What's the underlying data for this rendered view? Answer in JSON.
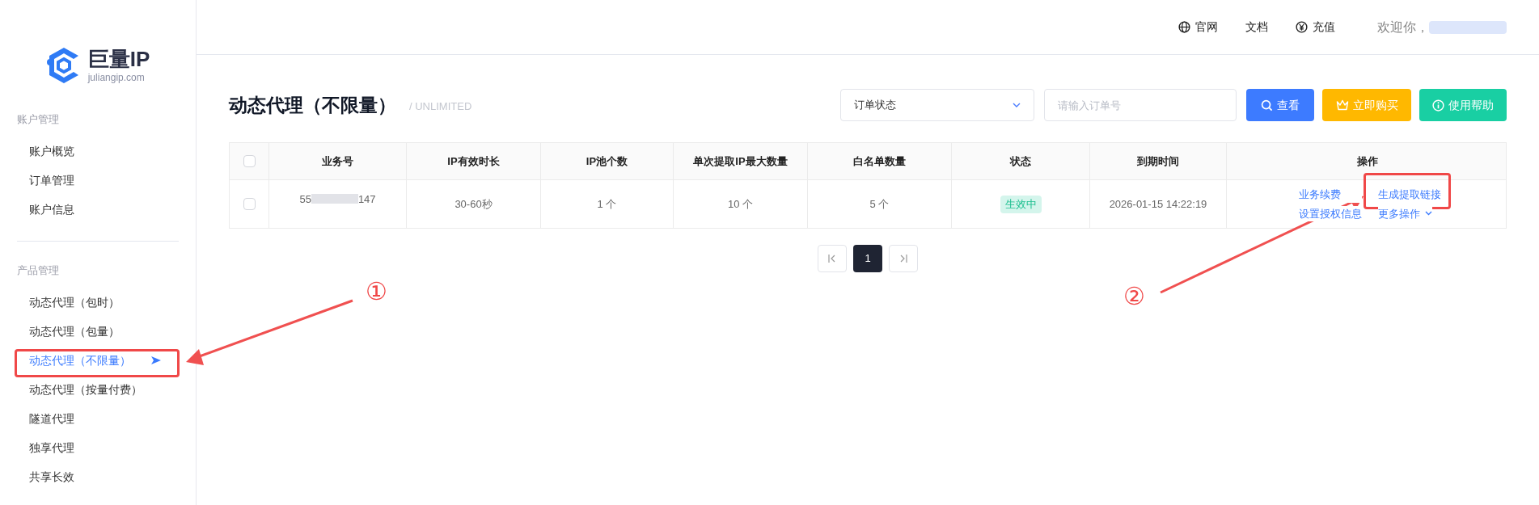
{
  "sidebar": {
    "logo": {
      "name": "巨量IP",
      "domain": "juliangip.com"
    },
    "sections": [
      {
        "title": "账户管理",
        "items": [
          {
            "label": "账户概览",
            "selected": false
          },
          {
            "label": "订单管理",
            "selected": false
          },
          {
            "label": "账户信息",
            "selected": false
          }
        ]
      },
      {
        "title": "产品管理",
        "items": [
          {
            "label": "动态代理（包时）",
            "selected": false
          },
          {
            "label": "动态代理（包量）",
            "selected": false
          },
          {
            "label": "动态代理（不限量）",
            "selected": true
          },
          {
            "label": "动态代理（按量付费）",
            "selected": false
          },
          {
            "label": "隧道代理",
            "selected": false
          },
          {
            "label": "独享代理",
            "selected": false
          },
          {
            "label": "共享长效",
            "selected": false
          }
        ]
      }
    ]
  },
  "header": {
    "links": [
      {
        "label": "官网",
        "kind": "globe"
      },
      {
        "label": "文档",
        "kind": "plain"
      },
      {
        "label": "充值",
        "kind": "yen"
      }
    ],
    "welcome": "欢迎你，"
  },
  "page": {
    "title": "动态代理（不限量）",
    "subtitle": "/ UNLIMITED"
  },
  "filters": {
    "status_select": "订单状态",
    "order_search": {
      "placeholder": "请输入订单号"
    },
    "buttons": [
      {
        "label": "查看",
        "kind": "search"
      },
      {
        "label": "立即购买",
        "kind": "buy"
      },
      {
        "label": "使用帮助",
        "kind": "help"
      }
    ]
  },
  "table": {
    "header_checked": false,
    "columns": [
      "业务号",
      "IP有效时长",
      "IP池个数",
      "单次提取IP最大数量",
      "白名单数量",
      "状态",
      "到期时间",
      "操作"
    ],
    "rows": [
      {
        "checked": false,
        "cells": [
          {
            "kind": "masked",
            "start": "55",
            "end": "147"
          },
          {
            "kind": "text",
            "text": "30-60秒"
          },
          {
            "kind": "text",
            "text": "1 个"
          },
          {
            "kind": "text",
            "text": "10 个"
          },
          {
            "kind": "text",
            "text": "5 个"
          },
          {
            "kind": "status",
            "text": "生效中"
          },
          {
            "kind": "text",
            "text": "2026-01-15 14:22:19"
          },
          {
            "kind": "actions",
            "actions": [
              {
                "label": "业务续费",
                "kind": "link"
              },
              {
                "label": "生成提取链接",
                "kind": "link"
              },
              {
                "label": "设置授权信息",
                "kind": "link"
              },
              {
                "label": "更多操作",
                "kind": "dropdown"
              }
            ]
          }
        ]
      }
    ]
  },
  "pagination": {
    "pages": [
      {
        "label": "1",
        "selected": true
      }
    ]
  },
  "annotations": [
    {
      "label": "①"
    },
    {
      "label": "②"
    }
  ]
}
